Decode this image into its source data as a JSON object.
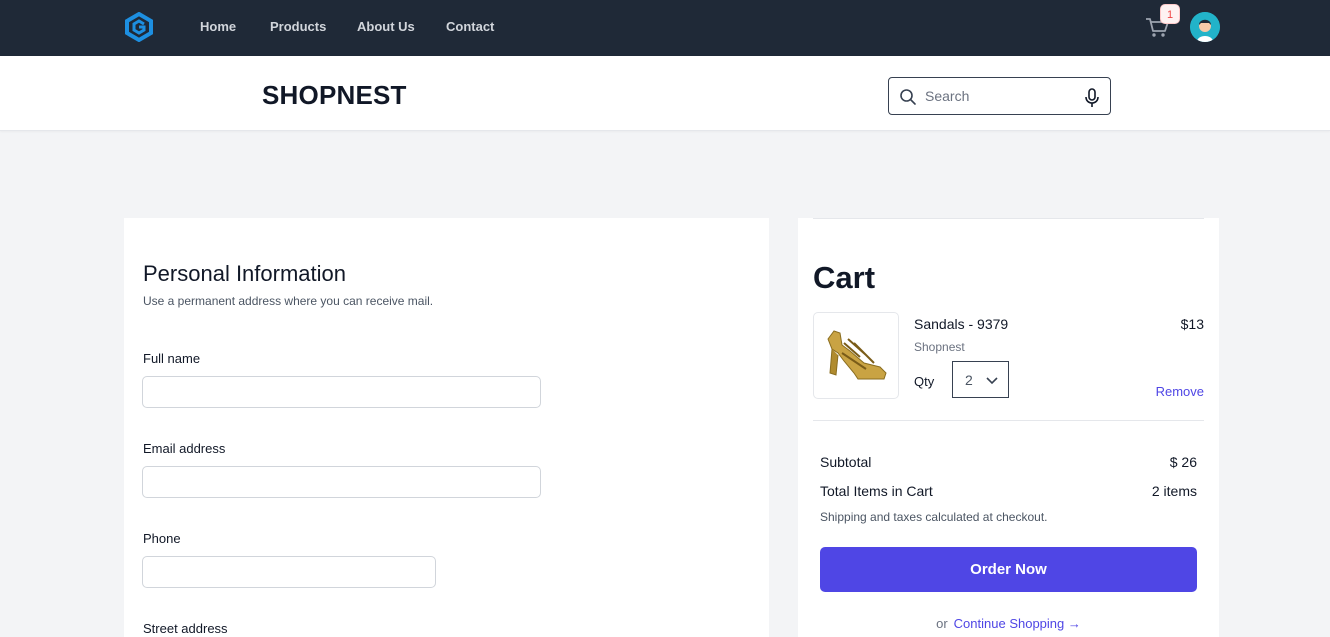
{
  "nav": {
    "links": [
      "Home",
      "Products",
      "About Us",
      "Contact"
    ],
    "cart_count": "1"
  },
  "header": {
    "brand": "SHOPNEST",
    "search_placeholder": "Search"
  },
  "personal_info": {
    "title": "Personal Information",
    "subtitle": "Use a permanent address where you can receive mail.",
    "fields": [
      {
        "label": "Full name",
        "value": ""
      },
      {
        "label": "Email address",
        "value": ""
      },
      {
        "label": "Phone",
        "value": ""
      },
      {
        "label": "Street address",
        "value": ""
      }
    ]
  },
  "cart": {
    "title": "Cart",
    "item": {
      "name": "Sandals - 9379",
      "brand": "Shopnest",
      "price": "$13",
      "qty_label": "Qty",
      "qty": "2",
      "remove_label": "Remove"
    },
    "summary": {
      "subtotal_label": "Subtotal",
      "subtotal_value": "$ 26",
      "items_label": "Total Items in Cart",
      "items_value": "2 items",
      "shipping_note": "Shipping and taxes calculated at checkout."
    },
    "order_label": "Order Now",
    "or_text": "or",
    "continue_label": "Continue Shopping →"
  },
  "colors": {
    "nav_bg": "#1f2937",
    "accent": "#4f46e5",
    "page_bg": "#f3f4f6"
  },
  "icons": [
    "logo-icon",
    "cart-icon",
    "avatar",
    "search-icon",
    "mic-icon",
    "chevron-down-icon"
  ]
}
